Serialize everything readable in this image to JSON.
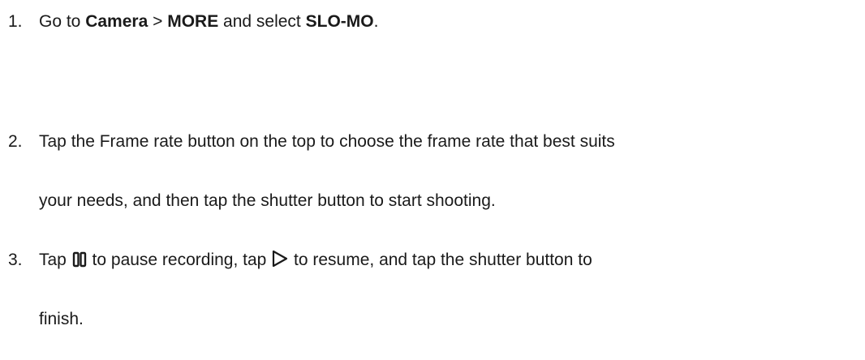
{
  "steps": [
    {
      "number": "1.",
      "line1": {
        "t1": "Go to ",
        "b1": "Camera",
        "t2": " > ",
        "b2": "MORE",
        "t3": " and select ",
        "b3": "SLO-MO",
        "t4": "."
      }
    },
    {
      "number": "2.",
      "line1": "Tap the Frame rate button on the top to choose the frame rate that best suits",
      "line2": "your needs, and then tap the shutter button to start shooting."
    },
    {
      "number": "3.",
      "line1": {
        "t1": "Tap ",
        "pause_icon": "pause-icon",
        "t2": " to pause recording, tap ",
        "play_icon": "play-icon",
        "t3": " to resume, and tap the shutter button to"
      },
      "line2": "finish."
    }
  ]
}
